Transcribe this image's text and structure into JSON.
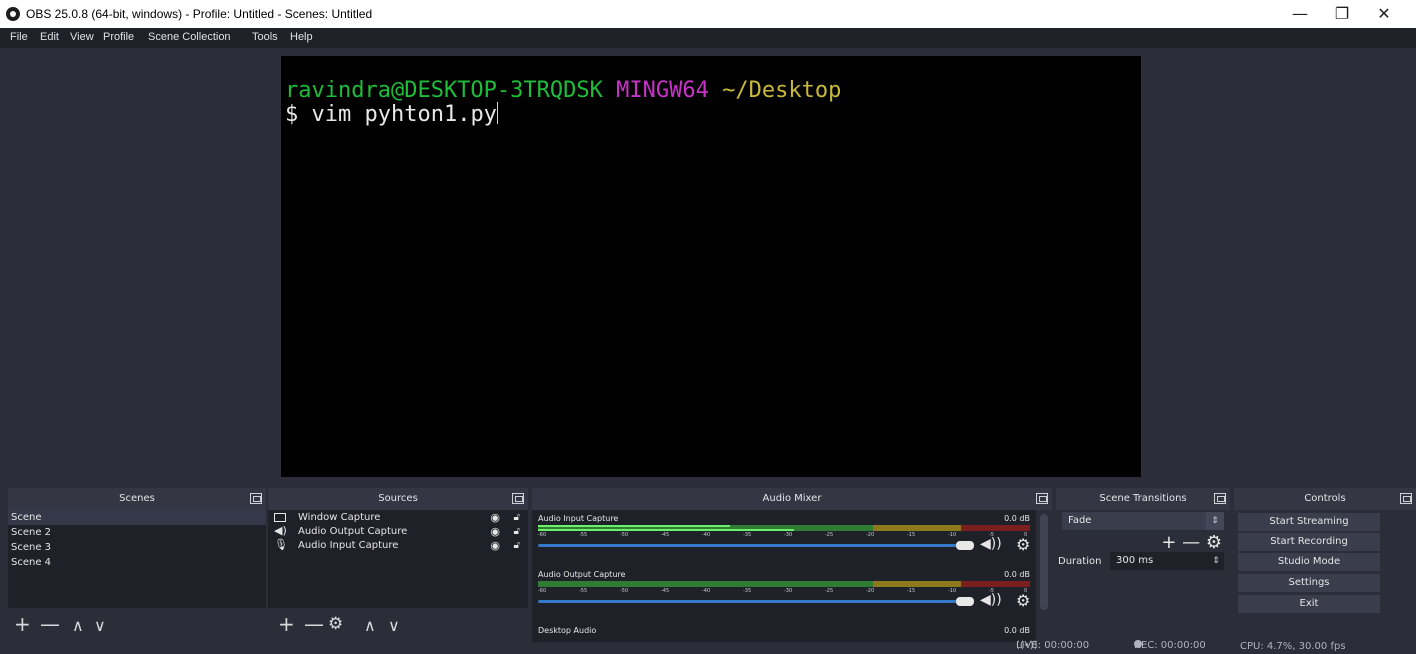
{
  "window": {
    "title": "OBS 25.0.8 (64-bit, windows) - Profile: Untitled - Scenes: Untitled",
    "minimize": "—",
    "restore": "❐",
    "close": "✕"
  },
  "menu": [
    "File",
    "Edit",
    "View",
    "Profile",
    "Scene Collection",
    "Tools",
    "Help"
  ],
  "terminal": {
    "user_host": "ravindra@DESKTOP-3TRQDSK",
    "env": "MINGW64",
    "path": "~/Desktop",
    "prompt": "$",
    "command": "vim pyhton1.py"
  },
  "scenes": {
    "header": "Scenes",
    "items": [
      "Scene",
      "Scene 2",
      "Scene 3",
      "Scene 4"
    ],
    "selected_index": 0,
    "toolbar": {
      "add": "+",
      "remove": "—",
      "up": "∧",
      "down": "∨"
    }
  },
  "sources": {
    "header": "Sources",
    "items": [
      {
        "label": "Window Capture",
        "icon": "monitor-icon"
      },
      {
        "label": "Audio Output Capture",
        "icon": "speaker-icon"
      },
      {
        "label": "Audio Input Capture",
        "icon": "microphone-icon"
      }
    ],
    "toolbar": {
      "add": "+",
      "remove": "—",
      "settings": "⚙",
      "up": "∧",
      "down": "∨"
    }
  },
  "mixer": {
    "header": "Audio Mixer",
    "ticks": [
      "-60",
      "-55",
      "-50",
      "-45",
      "-40",
      "-35",
      "-30",
      "-25",
      "-20",
      "-15",
      "-10",
      "-5",
      "0"
    ],
    "channels": [
      {
        "name": "Audio Input Capture",
        "db": "0.0 dB",
        "level": 0.52
      },
      {
        "name": "Audio Output Capture",
        "db": "0.0 dB",
        "level": 0.0
      },
      {
        "name": "Desktop Audio",
        "db": "0.0 dB",
        "level": 0.0
      }
    ]
  },
  "transitions": {
    "header": "Scene Transitions",
    "selected": "Fade",
    "duration_label": "Duration",
    "duration_value": "300 ms",
    "tools": "+ — ⚙"
  },
  "controls": {
    "header": "Controls",
    "buttons": [
      "Start Streaming",
      "Start Recording",
      "Studio Mode",
      "Settings",
      "Exit"
    ]
  },
  "status": {
    "live": "LIVE: 00:00:00",
    "rec": "REC: 00:00:00",
    "cpu": "CPU: 4.7%, 30.00 fps"
  },
  "colors": {
    "meter_green": "#2e7d32",
    "meter_yellow": "#8c7a1c",
    "meter_red": "#7a1e1e",
    "fader_blue": "#3478c8"
  }
}
